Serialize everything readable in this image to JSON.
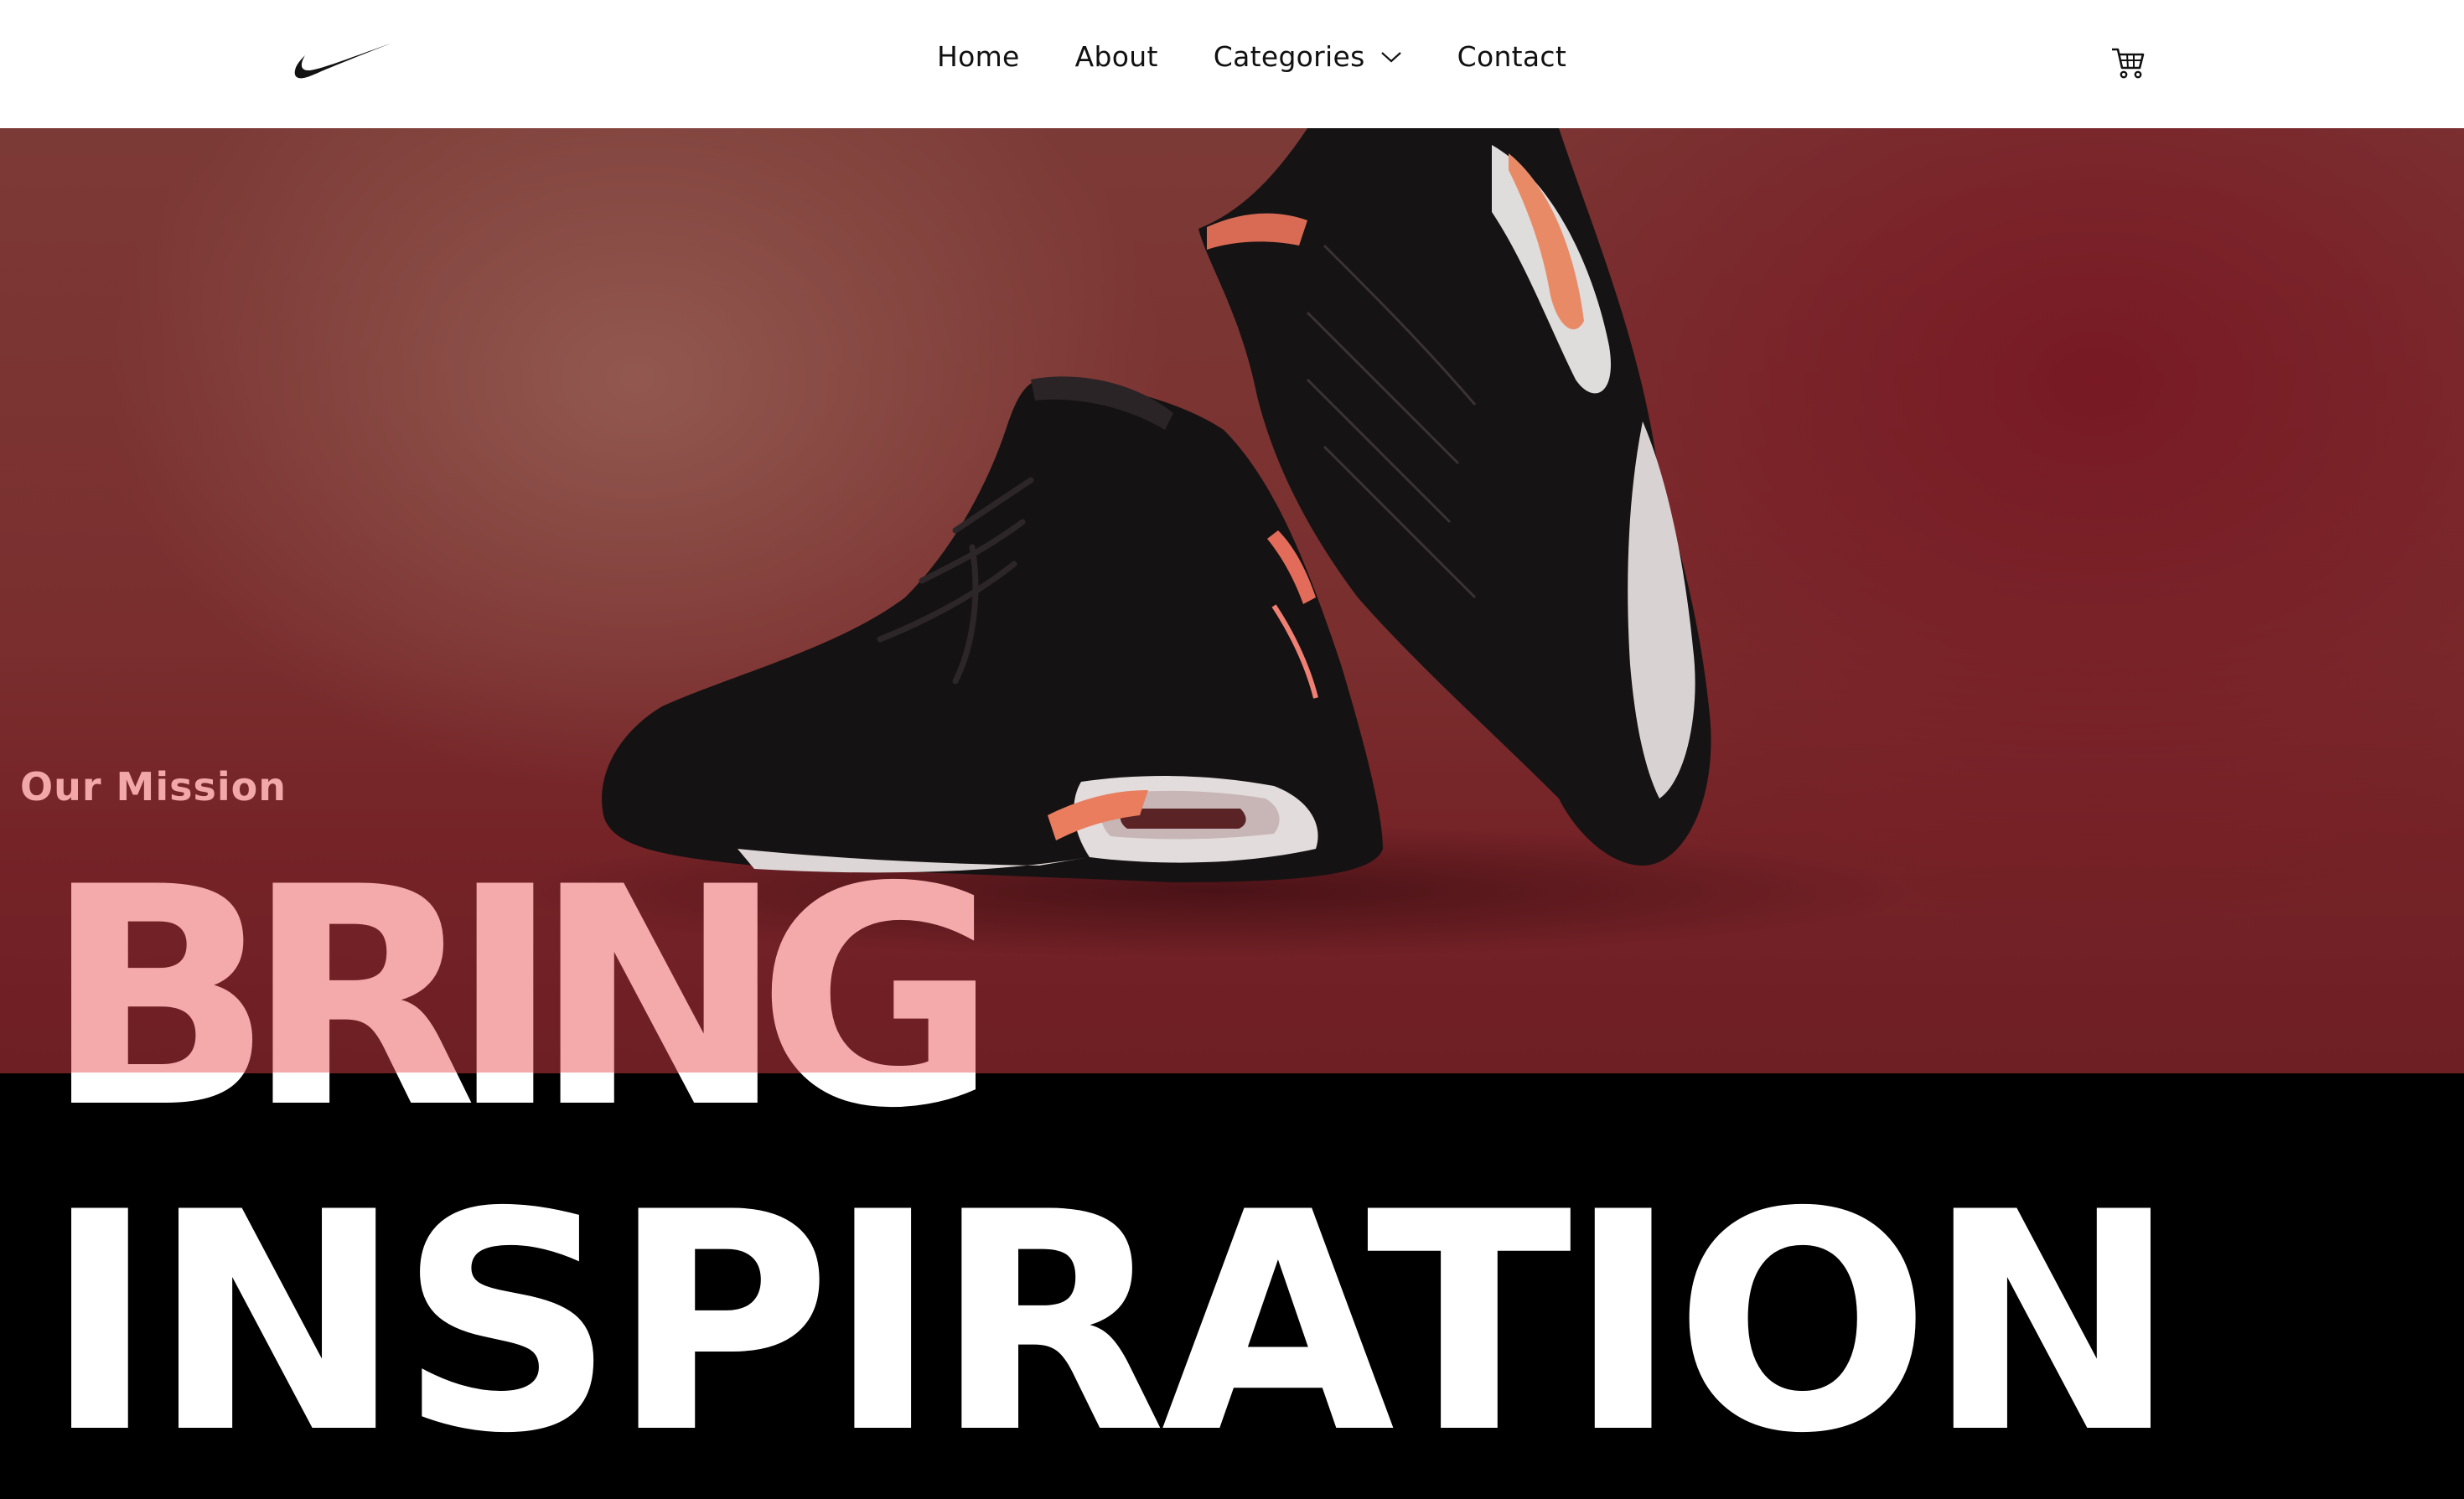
{
  "header": {
    "logo": "swoosh-logo",
    "nav": [
      {
        "label": "Home"
      },
      {
        "label": "About"
      },
      {
        "label": "Categories",
        "has_dropdown": true
      },
      {
        "label": "Contact"
      }
    ],
    "cart_icon": "cart-icon"
  },
  "hero": {
    "kicker": "Our Mission",
    "headline_line_1": "BRING",
    "headline_line_2": "INSPIRATION",
    "image": "sneakers-photo",
    "colors": {
      "hero_red": "#7a2e2e",
      "kicker_pink": "#f2a7a9",
      "headline_pink": "#f4a9ab",
      "headline_white": "#ffffff",
      "band_black": "#000000"
    }
  }
}
